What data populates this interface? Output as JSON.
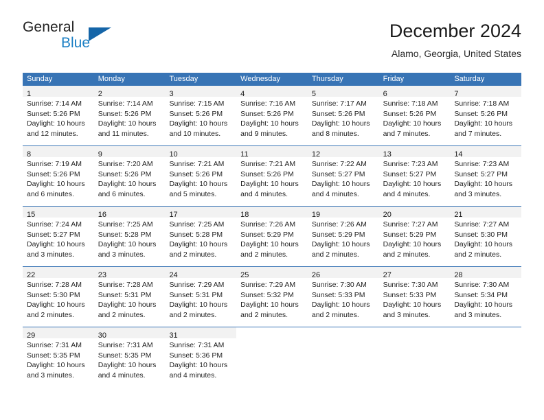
{
  "brand": {
    "name_part1": "General",
    "name_part2": "Blue",
    "triangle_color": "#1565a8",
    "blue_text_color": "#1b7fc4"
  },
  "header": {
    "title": "December 2024",
    "subtitle": "Alamo, Georgia, United States"
  },
  "theme": {
    "header_blue": "#3874b5",
    "day_strip_gray": "#f2f2f2",
    "text_color": "#1f1f1f"
  },
  "weekdays": [
    "Sunday",
    "Monday",
    "Tuesday",
    "Wednesday",
    "Thursday",
    "Friday",
    "Saturday"
  ],
  "weeks": [
    [
      {
        "day": "1",
        "sunrise": "Sunrise: 7:14 AM",
        "sunset": "Sunset: 5:26 PM",
        "daylight1": "Daylight: 10 hours",
        "daylight2": "and 12 minutes."
      },
      {
        "day": "2",
        "sunrise": "Sunrise: 7:14 AM",
        "sunset": "Sunset: 5:26 PM",
        "daylight1": "Daylight: 10 hours",
        "daylight2": "and 11 minutes."
      },
      {
        "day": "3",
        "sunrise": "Sunrise: 7:15 AM",
        "sunset": "Sunset: 5:26 PM",
        "daylight1": "Daylight: 10 hours",
        "daylight2": "and 10 minutes."
      },
      {
        "day": "4",
        "sunrise": "Sunrise: 7:16 AM",
        "sunset": "Sunset: 5:26 PM",
        "daylight1": "Daylight: 10 hours",
        "daylight2": "and 9 minutes."
      },
      {
        "day": "5",
        "sunrise": "Sunrise: 7:17 AM",
        "sunset": "Sunset: 5:26 PM",
        "daylight1": "Daylight: 10 hours",
        "daylight2": "and 8 minutes."
      },
      {
        "day": "6",
        "sunrise": "Sunrise: 7:18 AM",
        "sunset": "Sunset: 5:26 PM",
        "daylight1": "Daylight: 10 hours",
        "daylight2": "and 7 minutes."
      },
      {
        "day": "7",
        "sunrise": "Sunrise: 7:18 AM",
        "sunset": "Sunset: 5:26 PM",
        "daylight1": "Daylight: 10 hours",
        "daylight2": "and 7 minutes."
      }
    ],
    [
      {
        "day": "8",
        "sunrise": "Sunrise: 7:19 AM",
        "sunset": "Sunset: 5:26 PM",
        "daylight1": "Daylight: 10 hours",
        "daylight2": "and 6 minutes."
      },
      {
        "day": "9",
        "sunrise": "Sunrise: 7:20 AM",
        "sunset": "Sunset: 5:26 PM",
        "daylight1": "Daylight: 10 hours",
        "daylight2": "and 6 minutes."
      },
      {
        "day": "10",
        "sunrise": "Sunrise: 7:21 AM",
        "sunset": "Sunset: 5:26 PM",
        "daylight1": "Daylight: 10 hours",
        "daylight2": "and 5 minutes."
      },
      {
        "day": "11",
        "sunrise": "Sunrise: 7:21 AM",
        "sunset": "Sunset: 5:26 PM",
        "daylight1": "Daylight: 10 hours",
        "daylight2": "and 4 minutes."
      },
      {
        "day": "12",
        "sunrise": "Sunrise: 7:22 AM",
        "sunset": "Sunset: 5:27 PM",
        "daylight1": "Daylight: 10 hours",
        "daylight2": "and 4 minutes."
      },
      {
        "day": "13",
        "sunrise": "Sunrise: 7:23 AM",
        "sunset": "Sunset: 5:27 PM",
        "daylight1": "Daylight: 10 hours",
        "daylight2": "and 4 minutes."
      },
      {
        "day": "14",
        "sunrise": "Sunrise: 7:23 AM",
        "sunset": "Sunset: 5:27 PM",
        "daylight1": "Daylight: 10 hours",
        "daylight2": "and 3 minutes."
      }
    ],
    [
      {
        "day": "15",
        "sunrise": "Sunrise: 7:24 AM",
        "sunset": "Sunset: 5:27 PM",
        "daylight1": "Daylight: 10 hours",
        "daylight2": "and 3 minutes."
      },
      {
        "day": "16",
        "sunrise": "Sunrise: 7:25 AM",
        "sunset": "Sunset: 5:28 PM",
        "daylight1": "Daylight: 10 hours",
        "daylight2": "and 3 minutes."
      },
      {
        "day": "17",
        "sunrise": "Sunrise: 7:25 AM",
        "sunset": "Sunset: 5:28 PM",
        "daylight1": "Daylight: 10 hours",
        "daylight2": "and 2 minutes."
      },
      {
        "day": "18",
        "sunrise": "Sunrise: 7:26 AM",
        "sunset": "Sunset: 5:29 PM",
        "daylight1": "Daylight: 10 hours",
        "daylight2": "and 2 minutes."
      },
      {
        "day": "19",
        "sunrise": "Sunrise: 7:26 AM",
        "sunset": "Sunset: 5:29 PM",
        "daylight1": "Daylight: 10 hours",
        "daylight2": "and 2 minutes."
      },
      {
        "day": "20",
        "sunrise": "Sunrise: 7:27 AM",
        "sunset": "Sunset: 5:29 PM",
        "daylight1": "Daylight: 10 hours",
        "daylight2": "and 2 minutes."
      },
      {
        "day": "21",
        "sunrise": "Sunrise: 7:27 AM",
        "sunset": "Sunset: 5:30 PM",
        "daylight1": "Daylight: 10 hours",
        "daylight2": "and 2 minutes."
      }
    ],
    [
      {
        "day": "22",
        "sunrise": "Sunrise: 7:28 AM",
        "sunset": "Sunset: 5:30 PM",
        "daylight1": "Daylight: 10 hours",
        "daylight2": "and 2 minutes."
      },
      {
        "day": "23",
        "sunrise": "Sunrise: 7:28 AM",
        "sunset": "Sunset: 5:31 PM",
        "daylight1": "Daylight: 10 hours",
        "daylight2": "and 2 minutes."
      },
      {
        "day": "24",
        "sunrise": "Sunrise: 7:29 AM",
        "sunset": "Sunset: 5:31 PM",
        "daylight1": "Daylight: 10 hours",
        "daylight2": "and 2 minutes."
      },
      {
        "day": "25",
        "sunrise": "Sunrise: 7:29 AM",
        "sunset": "Sunset: 5:32 PM",
        "daylight1": "Daylight: 10 hours",
        "daylight2": "and 2 minutes."
      },
      {
        "day": "26",
        "sunrise": "Sunrise: 7:30 AM",
        "sunset": "Sunset: 5:33 PM",
        "daylight1": "Daylight: 10 hours",
        "daylight2": "and 2 minutes."
      },
      {
        "day": "27",
        "sunrise": "Sunrise: 7:30 AM",
        "sunset": "Sunset: 5:33 PM",
        "daylight1": "Daylight: 10 hours",
        "daylight2": "and 3 minutes."
      },
      {
        "day": "28",
        "sunrise": "Sunrise: 7:30 AM",
        "sunset": "Sunset: 5:34 PM",
        "daylight1": "Daylight: 10 hours",
        "daylight2": "and 3 minutes."
      }
    ],
    [
      {
        "day": "29",
        "sunrise": "Sunrise: 7:31 AM",
        "sunset": "Sunset: 5:35 PM",
        "daylight1": "Daylight: 10 hours",
        "daylight2": "and 3 minutes."
      },
      {
        "day": "30",
        "sunrise": "Sunrise: 7:31 AM",
        "sunset": "Sunset: 5:35 PM",
        "daylight1": "Daylight: 10 hours",
        "daylight2": "and 4 minutes."
      },
      {
        "day": "31",
        "sunrise": "Sunrise: 7:31 AM",
        "sunset": "Sunset: 5:36 PM",
        "daylight1": "Daylight: 10 hours",
        "daylight2": "and 4 minutes."
      },
      {
        "day": "",
        "sunrise": "",
        "sunset": "",
        "daylight1": "",
        "daylight2": ""
      },
      {
        "day": "",
        "sunrise": "",
        "sunset": "",
        "daylight1": "",
        "daylight2": ""
      },
      {
        "day": "",
        "sunrise": "",
        "sunset": "",
        "daylight1": "",
        "daylight2": ""
      },
      {
        "day": "",
        "sunrise": "",
        "sunset": "",
        "daylight1": "",
        "daylight2": ""
      }
    ]
  ]
}
